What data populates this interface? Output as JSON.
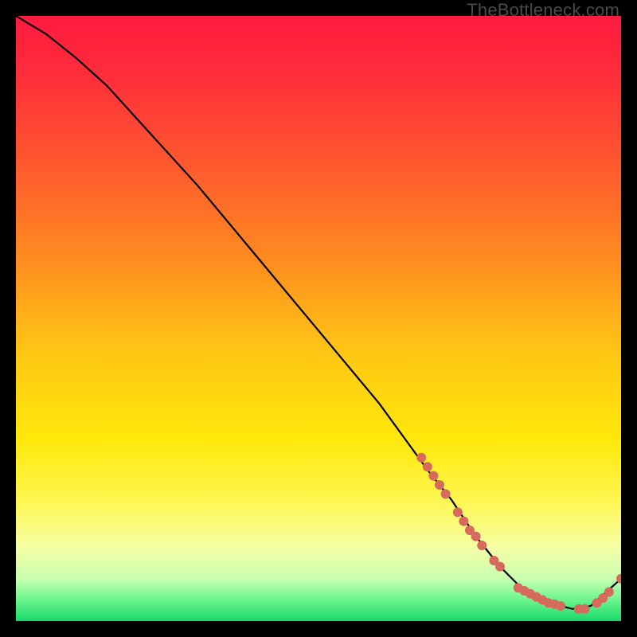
{
  "watermark": "TheBottleneck.com",
  "chart_data": {
    "type": "line",
    "title": "",
    "xlabel": "",
    "ylabel": "",
    "xlim": [
      0,
      100
    ],
    "ylim": [
      0,
      100
    ],
    "gradient_stops": [
      {
        "offset": 0.0,
        "color": "#ff1a3f"
      },
      {
        "offset": 0.1,
        "color": "#ff2e3a"
      },
      {
        "offset": 0.25,
        "color": "#ff5a2e"
      },
      {
        "offset": 0.4,
        "color": "#ff8b20"
      },
      {
        "offset": 0.55,
        "color": "#ffc414"
      },
      {
        "offset": 0.7,
        "color": "#ffe80a"
      },
      {
        "offset": 0.8,
        "color": "#fff650"
      },
      {
        "offset": 0.88,
        "color": "#f5ffa6"
      },
      {
        "offset": 0.93,
        "color": "#c8ffb0"
      },
      {
        "offset": 0.965,
        "color": "#6cf58e"
      },
      {
        "offset": 1.0,
        "color": "#18d96b"
      }
    ],
    "series": [
      {
        "name": "bottleneck-curve",
        "x": [
          0,
          5,
          10,
          15,
          20,
          30,
          40,
          50,
          60,
          68,
          72,
          76,
          80,
          84,
          88,
          92,
          95,
          100
        ],
        "y": [
          100,
          97,
          93,
          88.5,
          83,
          72,
          60,
          48,
          36,
          25,
          20,
          14,
          9,
          5,
          3,
          2,
          2.5,
          7
        ]
      }
    ],
    "markers": {
      "name": "highlighted-points",
      "color": "#d66a5c",
      "points": [
        {
          "x": 67,
          "y": 27
        },
        {
          "x": 68,
          "y": 25.5
        },
        {
          "x": 69,
          "y": 24
        },
        {
          "x": 70,
          "y": 22.5
        },
        {
          "x": 71,
          "y": 21
        },
        {
          "x": 73,
          "y": 18
        },
        {
          "x": 74,
          "y": 16.5
        },
        {
          "x": 75,
          "y": 15
        },
        {
          "x": 76,
          "y": 14
        },
        {
          "x": 77,
          "y": 12.5
        },
        {
          "x": 79,
          "y": 10
        },
        {
          "x": 80,
          "y": 9
        },
        {
          "x": 83,
          "y": 5.5
        },
        {
          "x": 84,
          "y": 5
        },
        {
          "x": 85,
          "y": 4.5
        },
        {
          "x": 86,
          "y": 4
        },
        {
          "x": 87,
          "y": 3.5
        },
        {
          "x": 88,
          "y": 3
        },
        {
          "x": 89,
          "y": 2.8
        },
        {
          "x": 90,
          "y": 2.5
        },
        {
          "x": 93,
          "y": 2
        },
        {
          "x": 94,
          "y": 2
        },
        {
          "x": 96,
          "y": 3
        },
        {
          "x": 97,
          "y": 3.8
        },
        {
          "x": 98,
          "y": 4.8
        },
        {
          "x": 100,
          "y": 7
        }
      ]
    }
  }
}
